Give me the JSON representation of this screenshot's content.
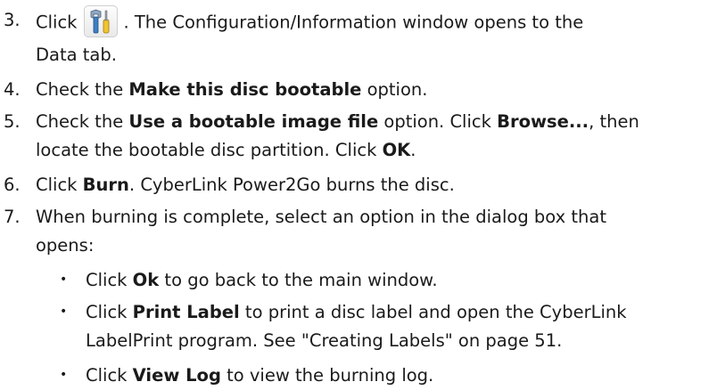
{
  "steps": [
    {
      "number": "3.",
      "line1_before": "Click",
      "icon": "configuration-tools-icon",
      "line1_after": ". The Configuration/Information window opens to the",
      "line2": "Data tab."
    },
    {
      "number": "4.",
      "p1": "Check the ",
      "b1": "Make this disc bootable",
      "p2": " option."
    },
    {
      "number": "5.",
      "p1": "Check the ",
      "b1": "Use a bootable image file",
      "p2": " option. Click ",
      "b2": "Browse...",
      "p3": ", then",
      "line2_p1": "locate the bootable disc partition. Click ",
      "line2_b1": "OK",
      "line2_p2": "."
    },
    {
      "number": "6.",
      "p1": "Click ",
      "b1": "Burn",
      "p2": ". CyberLink Power2Go burns the disc."
    },
    {
      "number": "7.",
      "line1": "When burning is complete, select an option in the dialog box that",
      "line2": "opens:"
    }
  ],
  "bullets": [
    {
      "symbol": "•",
      "p1": "Click ",
      "b1": "Ok",
      "p2": " to go back to the main window."
    },
    {
      "symbol": "•",
      "p1": "Click ",
      "b1": "Print Label",
      "p2": " to print a disc label and open the CyberLink",
      "line2": "LabelPrint program. See \"Creating Labels\" on page 51."
    },
    {
      "symbol": "•",
      "p1": "Click ",
      "b1": "View Log",
      "p2": " to view the burning log."
    }
  ]
}
